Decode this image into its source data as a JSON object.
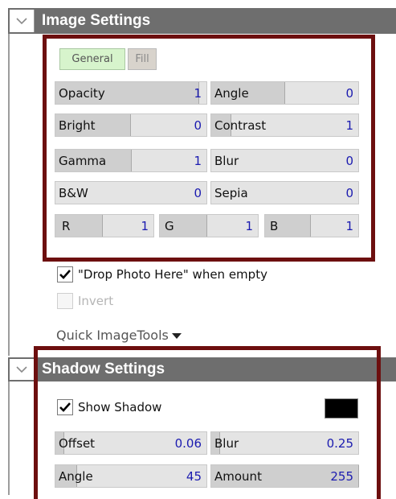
{
  "image_settings": {
    "title": "Image Settings",
    "tabs": [
      {
        "label": "General",
        "active": true
      },
      {
        "label": "Fill",
        "active": false
      }
    ],
    "fields": {
      "opacity": {
        "label": "Opacity",
        "value": "1"
      },
      "angle": {
        "label": "Angle",
        "value": "0"
      },
      "bright": {
        "label": "Bright",
        "value": "0"
      },
      "contrast": {
        "label": "Contrast",
        "value": "1"
      },
      "gamma": {
        "label": "Gamma",
        "value": "1"
      },
      "blur": {
        "label": "Blur",
        "value": "0"
      },
      "bw": {
        "label": "B&W",
        "value": "0"
      },
      "sepia": {
        "label": "Sepia",
        "value": "0"
      },
      "r": {
        "label": "R",
        "value": "1"
      },
      "g": {
        "label": "G",
        "value": "1"
      },
      "b": {
        "label": "B",
        "value": "1"
      }
    },
    "drop_photo": {
      "label": "\"Drop Photo Here\" when empty",
      "checked": true
    },
    "invert": {
      "label": "Invert",
      "checked": false,
      "enabled": false
    },
    "quick_tools_label": "Quick ImageTools"
  },
  "shadow_settings": {
    "title": "Shadow Settings",
    "show_shadow": {
      "label": "Show Shadow",
      "checked": true
    },
    "shadow_color": "#000000",
    "fields": {
      "offset": {
        "label": "Offset",
        "value": "0.06"
      },
      "blur": {
        "label": "Blur",
        "value": "0.25"
      },
      "angle": {
        "label": "Angle",
        "value": "45"
      },
      "amount": {
        "label": "Amount",
        "value": "255"
      }
    }
  },
  "colors": {
    "header_bg": "#6e6e6e",
    "highlight_border": "#6d0f0f",
    "value_text": "#1b1bb0",
    "active_tab": "#d7f4cc"
  }
}
